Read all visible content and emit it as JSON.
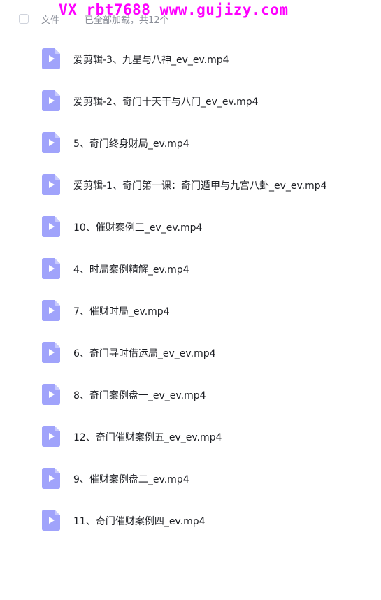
{
  "watermark": "VX rbt7688  www.gujizy.com",
  "header": {
    "file_column_label": "文件",
    "load_status": "已全部加载，共12个"
  },
  "colors": {
    "icon_fill": "#a0a3fb",
    "text": "#1d1f24",
    "muted": "#8b8f99",
    "watermark": "#ff00ff"
  },
  "files": [
    {
      "name": "爱剪辑-3、九星与八神_ev_ev.mp4",
      "icon": "video-file-icon"
    },
    {
      "name": "爱剪辑-2、奇门十天干与八门_ev_ev.mp4",
      "icon": "video-file-icon"
    },
    {
      "name": "5、奇门终身财局_ev.mp4",
      "icon": "video-file-icon"
    },
    {
      "name": "爱剪辑-1、奇门第一课：奇门遁甲与九宫八卦_ev_ev.mp4",
      "icon": "video-file-icon"
    },
    {
      "name": "10、催财案例三_ev_ev.mp4",
      "icon": "video-file-icon"
    },
    {
      "name": "4、时局案例精解_ev.mp4",
      "icon": "video-file-icon"
    },
    {
      "name": "7、催财时局_ev.mp4",
      "icon": "video-file-icon"
    },
    {
      "name": "6、奇门寻时借运局_ev_ev.mp4",
      "icon": "video-file-icon"
    },
    {
      "name": "8、奇门案例盘一_ev_ev.mp4",
      "icon": "video-file-icon"
    },
    {
      "name": "12、奇门催财案例五_ev_ev.mp4",
      "icon": "video-file-icon"
    },
    {
      "name": "9、催财案例盘二_ev.mp4",
      "icon": "video-file-icon"
    },
    {
      "name": "11、奇门催财案例四_ev.mp4",
      "icon": "video-file-icon"
    }
  ]
}
